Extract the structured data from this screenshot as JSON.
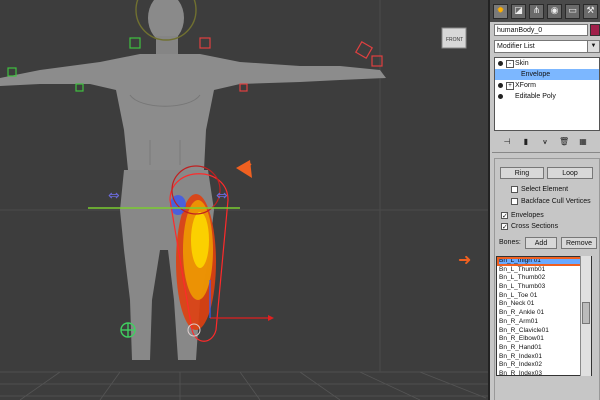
{
  "panel": {
    "tab_icons": [
      "sun-icon",
      "pointer-icon",
      "hierarchy-icon",
      "motion-icon",
      "display-icon",
      "hammer-icon"
    ],
    "object_name": "humanBody_0",
    "object_color": "#a0204a",
    "modifier_list_label": "Modifier List",
    "stack": [
      {
        "label": "Skin",
        "expand": "-",
        "selected": false,
        "sub": false
      },
      {
        "label": "Envelope",
        "expand": "",
        "selected": true,
        "sub": true
      },
      {
        "label": "XForm",
        "expand": "+",
        "selected": false,
        "sub": false
      },
      {
        "label": "Editable Poly",
        "expand": "",
        "selected": false,
        "sub": false
      }
    ],
    "ring_label": "Ring",
    "loop_label": "Loop",
    "select_element_label": "Select Element",
    "backface_cull_label": "Backface Cull Vertices",
    "envelopes_label": "Envelopes",
    "cross_sections_label": "Cross Sections",
    "bones_label": "Bones:",
    "add_label": "Add",
    "remove_label": "Remove",
    "bones": [
      "Bn_L_thigh 01",
      "Bn_L_Thumb01",
      "Bn_L_Thumb02",
      "Bn_L_Thumb03",
      "Bn_L_Toe 01",
      "Bn_Neck 01",
      "Bn_R_Ankle 01",
      "Bn_R_Arm01",
      "Bn_R_Clavicle01",
      "Bn_R_Elbow01",
      "Bn_R_Hand01",
      "Bn_R_Index01",
      "Bn_R_Index02",
      "Bn_R_Index03"
    ],
    "selected_bone": "Bn_L_thigh 01"
  },
  "viewport": {
    "cube_label": "FRONT",
    "accent_colors": {
      "callout": "#f06020",
      "envelope": "#ff2a2a",
      "grid": "#555555"
    }
  }
}
